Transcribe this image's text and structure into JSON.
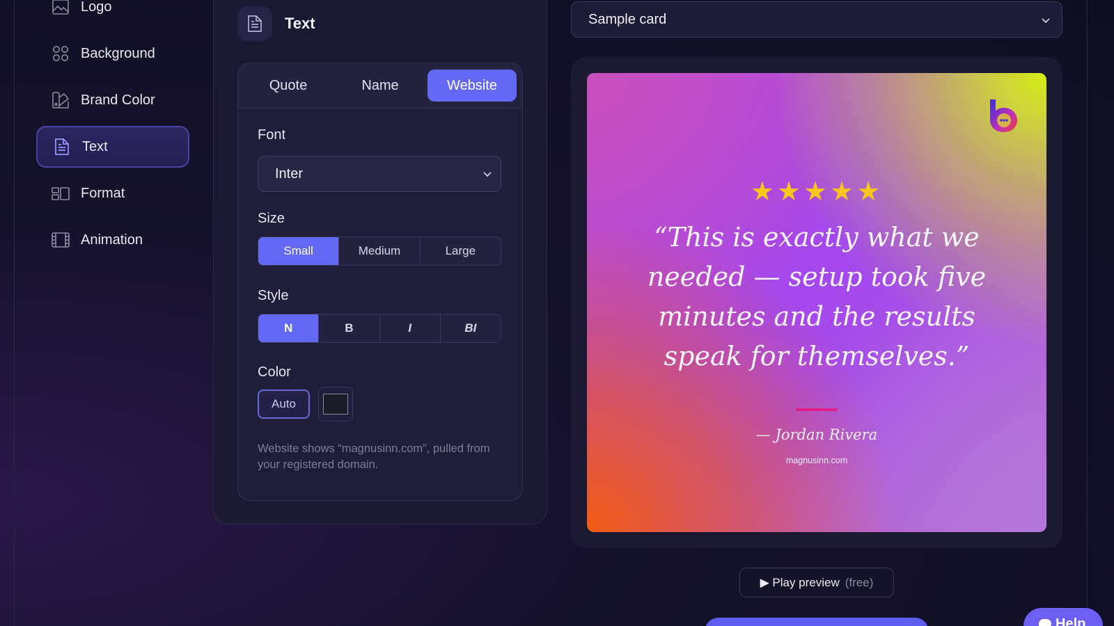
{
  "sidebar": {
    "items": [
      {
        "label": "Logo",
        "icon": "image-icon",
        "active": false
      },
      {
        "label": "Background",
        "icon": "grid-icon",
        "active": false
      },
      {
        "label": "Brand Color",
        "icon": "palette-icon",
        "active": false
      },
      {
        "label": "Text",
        "icon": "document-icon",
        "active": true
      },
      {
        "label": "Format",
        "icon": "layout-icon",
        "active": false
      },
      {
        "label": "Animation",
        "icon": "film-icon",
        "active": false
      }
    ]
  },
  "panel": {
    "title": "Text",
    "tabs": [
      {
        "label": "Quote",
        "active": false
      },
      {
        "label": "Name",
        "active": false
      },
      {
        "label": "Website",
        "active": true
      }
    ],
    "font": {
      "label": "Font",
      "value": "Inter"
    },
    "size": {
      "label": "Size",
      "options": [
        "Small",
        "Medium",
        "Large"
      ],
      "selected": "Small"
    },
    "style": {
      "label": "Style",
      "options": [
        "N",
        "B",
        "I",
        "BI"
      ],
      "selected": "N"
    },
    "color": {
      "label": "Color",
      "auto_label": "Auto",
      "swatch": "#1b1c28"
    },
    "hint": "Website shows “magnusinn.com”, pulled from your registered domain."
  },
  "preview": {
    "sample_select": "Sample card",
    "card": {
      "stars": "★★★★★",
      "rating": 5,
      "quote": "“This is exactly what we needed — setup took five minutes and the results speak for themselves.”",
      "author": "— Jordan Rivera",
      "website": "magnusinn.com"
    },
    "play_label": "▶ Play preview",
    "play_free": "(free)"
  },
  "help": {
    "label": "Help"
  },
  "colors": {
    "accent": "#6368f5",
    "star": "#f7c51c",
    "divider": "#e0208a",
    "background": "#15122b"
  }
}
